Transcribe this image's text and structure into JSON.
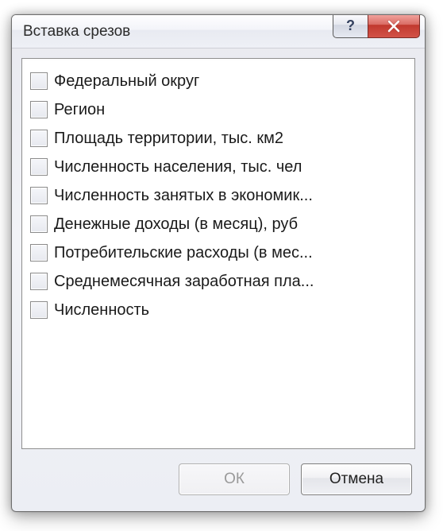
{
  "dialog": {
    "title": "Вставка срезов",
    "help_glyph": "?",
    "items": [
      {
        "label": "Федеральный округ",
        "checked": false
      },
      {
        "label": "Регион",
        "checked": false
      },
      {
        "label": "Площадь территории, тыс. км2",
        "checked": false
      },
      {
        "label": "Численность населения, тыс. чел",
        "checked": false
      },
      {
        "label": "Численность занятых в экономик...",
        "checked": false
      },
      {
        "label": "Денежные доходы (в месяц), руб",
        "checked": false
      },
      {
        "label": "Потребительские расходы (в мес...",
        "checked": false
      },
      {
        "label": "Среднемесячная заработная пла...",
        "checked": false
      },
      {
        "label": "Численность",
        "checked": false
      }
    ],
    "buttons": {
      "ok": "ОК",
      "cancel": "Отмена"
    }
  }
}
